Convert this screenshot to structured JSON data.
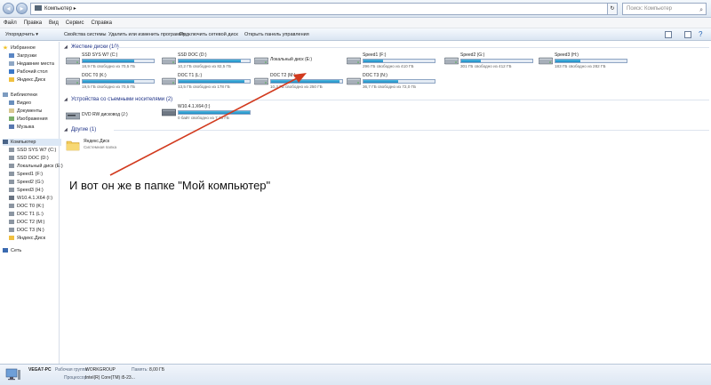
{
  "address": {
    "path": "Компьютер",
    "search_placeholder": "Поиск: Компьютер"
  },
  "menu": [
    "Файл",
    "Правка",
    "Вид",
    "Сервис",
    "Справка"
  ],
  "toolbar": {
    "organize": "Упорядочить ▾",
    "items": [
      "Свойства системы",
      "Удалить или изменить программу",
      "Подключить сетевой диск",
      "Открыть панель управления"
    ]
  },
  "sidebar": {
    "favorites": {
      "title": "Избранное",
      "items": [
        "Загрузки",
        "Недавние места",
        "Рабочий стол",
        "Яндекс.Диск"
      ]
    },
    "libraries": {
      "title": "Библиотеки",
      "items": [
        "Видео",
        "Документы",
        "Изображения",
        "Музыка"
      ]
    },
    "computer": {
      "title": "Компьютер",
      "items": [
        "SSD SYS W7 (C:)",
        "SSD DOC (D:)",
        "Локальный диск (E:)",
        "Speed1 (F:)",
        "Speed2 (G:)",
        "Speed3 (H:)",
        "W10.4.1.X64 (I:)",
        "DOC T0 (K:)",
        "DOC T1 (L:)",
        "DOC T2 (M:)",
        "DOC T3 (N:)",
        "Яндекс.Диск"
      ]
    },
    "network": {
      "title": "Сеть"
    }
  },
  "groups": {
    "hdd": "Жесткие диски (10)",
    "removable": "Устройства со съемными носителями (2)",
    "other": "Другие (1)"
  },
  "drives": [
    {
      "name": "SSD SYS W7 (C:)",
      "free": "18,9 ГБ свободно из 70,5 ГБ",
      "used": 0.73
    },
    {
      "name": "SSD DOC (D:)",
      "free": "10,2 ГБ свободно из 82,5 ГБ",
      "used": 0.88
    },
    {
      "name": "Локальный диск (E:)",
      "free": "",
      "used": 0
    },
    {
      "name": "Speed1 (F:)",
      "free": "296 ГБ свободно из 410 ГБ",
      "used": 0.28
    },
    {
      "name": "Speed2 (G:)",
      "free": "301 ГБ свободно из 412 ГБ",
      "used": 0.27
    },
    {
      "name": "Speed3 (H:)",
      "free": "183 ГБ свободно из 282 ГБ",
      "used": 0.35
    },
    {
      "name": "DOC T0 (K:)",
      "free": "19,5 ГБ свободно из 70,5 ГБ",
      "used": 0.72
    },
    {
      "name": "DOC T1 (L:)",
      "free": "13,5 ГБ свободно из 178 ГБ",
      "used": 0.92
    },
    {
      "name": "DOC T2 (M:)",
      "free": "10,3 ГБ свободно из 250 ГБ",
      "used": 0.96
    },
    {
      "name": "DOC T3 (N:)",
      "free": "36,7 ГБ свободно из 72,0 ГБ",
      "used": 0.49
    }
  ],
  "removable": [
    {
      "name": "DVD RW дисковод (J:)"
    },
    {
      "name": "W10.4.1.X64 (I:)",
      "free": "0 байт свободно из 7,20 ГБ",
      "used": 1.0
    }
  ],
  "other": [
    {
      "name": "Яндекс.Диск",
      "sub": "Системная папка"
    }
  ],
  "annotation": "И вот он же в папке \"Мой компьютер\"",
  "details": {
    "pc_name": "VEGA7-PC",
    "workgroup_label": "Рабочая группа:",
    "workgroup": "WORKGROUP",
    "memory_label": "Память:",
    "memory": "8,00 ГБ",
    "cpu_label": "Процессор:",
    "cpu": "Intel(R) Core(TM) i5-23..."
  },
  "colors": {
    "accent": "#1e3287",
    "bar_fill": "#1e8ac4",
    "arrow": "#d23a1e"
  }
}
